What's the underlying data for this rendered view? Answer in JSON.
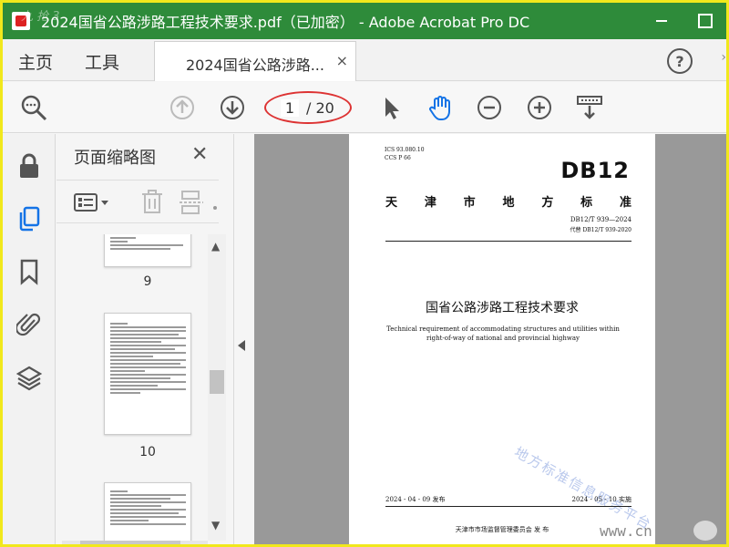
{
  "window": {
    "title": "2024国省公路涉路工程技术要求.pdf（已加密） - Adobe Acrobat Pro DC",
    "logo_watermark": "九 抢 3"
  },
  "menu": {
    "home": "主页",
    "tools": "工具"
  },
  "tab": {
    "label": "2024国省公路涉路...",
    "close": "×"
  },
  "toolbar": {
    "page_current": "1",
    "page_total": "/ 20"
  },
  "thumbnails": {
    "title": "页面缩略图",
    "close": "✕",
    "pages": [
      {
        "num": "9"
      },
      {
        "num": "10"
      }
    ]
  },
  "document": {
    "ics": "ICS  93.080.10",
    "ccs": "CCS  P  66",
    "db": "DB12",
    "region_chars": [
      "天",
      "津",
      "市",
      "地",
      "方",
      "标",
      "准"
    ],
    "code": "DB12/T  939—2024",
    "replace": "代替  DB12/T  939-2020",
    "title_cn": "国省公路涉路工程技术要求",
    "title_en": "Technical requirement of accommodating structures and utilities within right-of-way of national and provincial highway",
    "watermark": "地方标准信息服务平台",
    "issue_date": "2024 - 04 - 09 发布",
    "impl_date": "2024 - 05 - 10 实施",
    "publisher": "天津市市场监督管理委员会     发  布"
  },
  "corner_watermark": "www.cn",
  "colors": {
    "titlebar": "#2e8b3a",
    "frame": "#f1e81c",
    "annotation": "#dd3333",
    "accent_blue": "#1473e6"
  }
}
